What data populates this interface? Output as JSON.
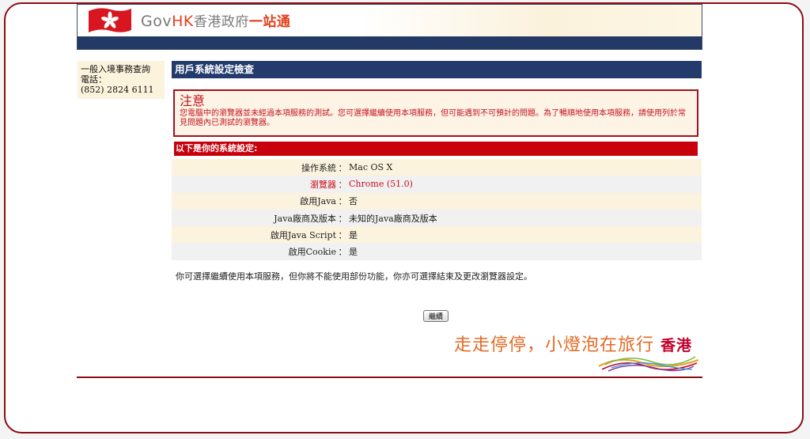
{
  "header": {
    "brand_gov": "Gov",
    "brand_hk": "HK",
    "brand_cn": "香港政府",
    "brand_cn2": "一站通",
    "flag_icon": "hong-kong-flag-icon"
  },
  "sidebar": {
    "line1": "一般入境事務查詢",
    "line2": "電話：",
    "line3": "(852) 2824 6111"
  },
  "main": {
    "title": "用戶系統設定檢查",
    "notice_title": "注意",
    "notice_text": "您電腦中的瀏覽器並未經過本項服務的測試。您可選擇繼續使用本項服務，但可能遇到不可預計的問題。為了暢順地使用本項服務，請使用列於常見問題內已測試的瀏覽器。",
    "settings_header": "以下是你的系統設定:",
    "separator": "：",
    "settings": [
      {
        "label": "操作系統",
        "value": "Mac OS X"
      },
      {
        "label": "瀏覽器",
        "value": "Chrome (51.0)"
      },
      {
        "label": "啟用Java",
        "value": "否"
      },
      {
        "label": "Java廠商及版本",
        "value": "未知的Java廠商及版本"
      },
      {
        "label": "啟用Java Script",
        "value": "是"
      },
      {
        "label": "啟用Cookie",
        "value": "是"
      }
    ],
    "message": "你可選擇繼續使用本項服務，但你將不能使用部份功能，你亦可選擇結束及更改瀏覽器設定。",
    "continue_label": "繼續"
  },
  "promo": {
    "slogan": "走走停停，小燈泡在旅行",
    "slogan_hk": "香港"
  },
  "colors": {
    "accent_red": "#c8000b",
    "navy": "#223a6c",
    "frame": "#8b0d14"
  }
}
